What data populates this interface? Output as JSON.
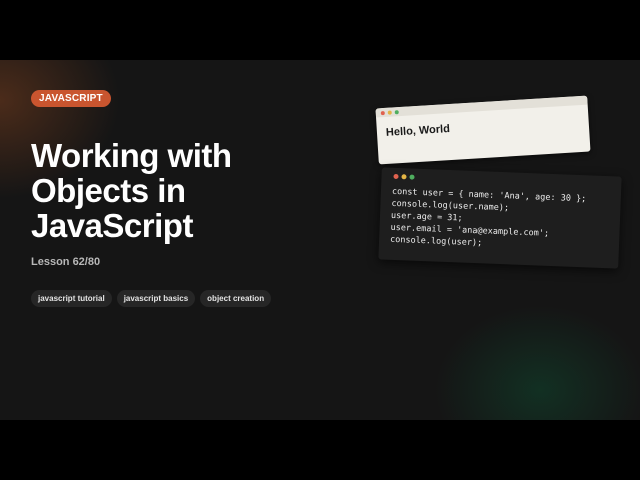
{
  "badge": {
    "label": "JAVASCRIPT",
    "color": "#c9552f"
  },
  "title": {
    "lines": [
      "Working with",
      "Objects in",
      "JavaScript"
    ]
  },
  "lesson": {
    "label": "Lesson 62/80"
  },
  "tags": [
    {
      "label": "javascript tutorial"
    },
    {
      "label": "javascript basics"
    },
    {
      "label": "object creation"
    }
  ],
  "browser_preview": {
    "output_text": "Hello, World"
  },
  "code_snippet": {
    "lines": [
      "const user = { name: 'Ana', age: 30 };",
      "console.log(user.name);",
      "user.age = 31;",
      "user.email = 'ana@example.com';",
      "console.log(user);"
    ]
  },
  "window_dots": {
    "close_color": "#e0624f",
    "minimize_color": "#e3b445",
    "maximize_color": "#4fae5f"
  },
  "colors": {
    "background": "#151515",
    "warm_glow": "#783e1e",
    "cool_glow": "#10462e"
  }
}
